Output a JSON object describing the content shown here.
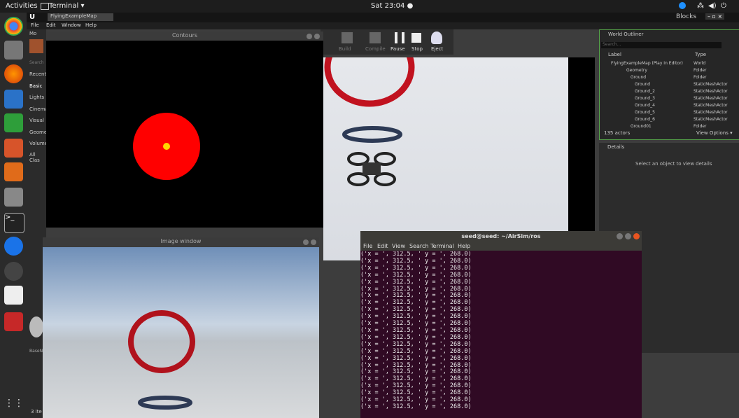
{
  "topbar": {
    "activities": "Activities",
    "terminal_menu": "Terminal ▾",
    "clock": "Sat 23:04 ●"
  },
  "editor": {
    "tab_title": "FlyingExampleMap",
    "menu": [
      "File",
      "Edit",
      "Window",
      "Help"
    ],
    "blocks": "Blocks",
    "toolbar": [
      "Build",
      "Compile",
      "Pause",
      "Stop",
      "Eject"
    ],
    "modes_tab": "Mo",
    "modes_search": "Search",
    "modes_list": [
      "Recent",
      "Basic",
      "Lights",
      "Cinema",
      "Visual",
      "Geome",
      "Volume",
      "All Clas"
    ],
    "content_footer": "3 ite",
    "content_asset": "BaseN"
  },
  "outliner": {
    "title": "World Outliner",
    "search_placeholder": "Search...",
    "col_label": "Label",
    "col_type": "Type",
    "rows": [
      {
        "label": "FlyingExampleMap (Play In Editor)",
        "type": "World"
      },
      {
        "label": "Geometry",
        "type": "Folder"
      },
      {
        "label": "Ground",
        "type": "Folder"
      },
      {
        "label": "Ground",
        "type": "StaticMeshActor"
      },
      {
        "label": "Ground_2",
        "type": "StaticMeshActor"
      },
      {
        "label": "Ground_3",
        "type": "StaticMeshActor"
      },
      {
        "label": "Ground_4",
        "type": "StaticMeshActor"
      },
      {
        "label": "Ground_5",
        "type": "StaticMeshActor"
      },
      {
        "label": "Ground_6",
        "type": "StaticMeshActor"
      },
      {
        "label": "Ground01",
        "type": "Folder"
      }
    ],
    "actors": "135 actors",
    "view_options": "View Options ▾"
  },
  "details": {
    "title": "Details",
    "empty": "Select an object to view details"
  },
  "contours": {
    "title": "Contours"
  },
  "image_window": {
    "title": "Image window"
  },
  "terminal": {
    "title": "seed@seed: ~/AirSim/ros",
    "menu": [
      "File",
      "Edit",
      "View",
      "Search",
      "Terminal",
      "Help"
    ],
    "line": "('x = ', 312.5, ' y = ', 268.0)"
  }
}
